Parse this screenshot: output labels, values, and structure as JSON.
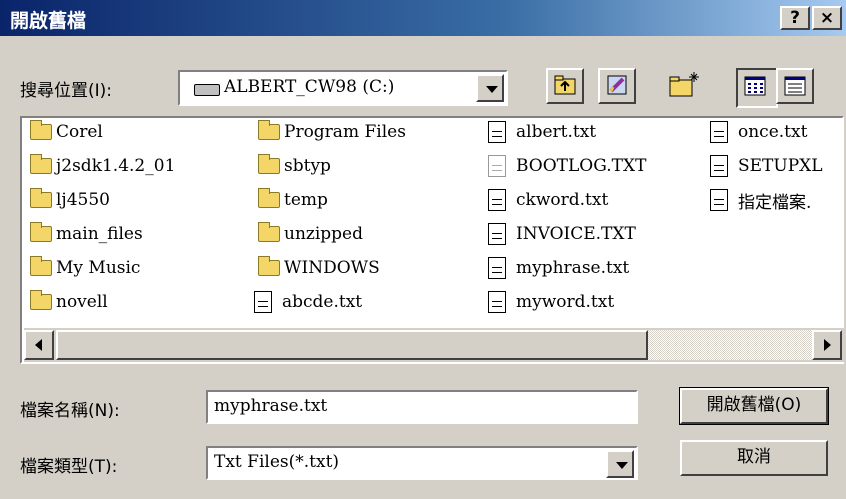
{
  "window": {
    "title": "開啟舊檔",
    "help_label": "?",
    "close_label": "×"
  },
  "toolbar": {
    "lookin_label": "搜尋位置(I):",
    "lookin_value": "ALBERT_CW98 (C:)"
  },
  "files": {
    "col1": [
      "Corel",
      "j2sdk1.4.2_01",
      "lj4550",
      "main_files",
      "My Music",
      "novell"
    ],
    "col2": [
      "Program Files",
      "sbtyp",
      "temp",
      "unzipped",
      "WINDOWS",
      "abcde.txt"
    ],
    "col3": [
      "albert.txt",
      "BOOTLOG.TXT",
      "ckword.txt",
      "INVOICE.TXT",
      "myphrase.txt",
      "myword.txt"
    ],
    "col4": [
      "once.txt",
      "SETUPXL",
      "指定檔案."
    ]
  },
  "form": {
    "filename_label": "檔案名稱(N):",
    "filename_value": "myphrase.txt",
    "filetype_label": "檔案類型(T):",
    "filetype_value": "Txt Files(*.txt)",
    "open_label": "開啟舊檔(O)",
    "cancel_label": "取消"
  }
}
